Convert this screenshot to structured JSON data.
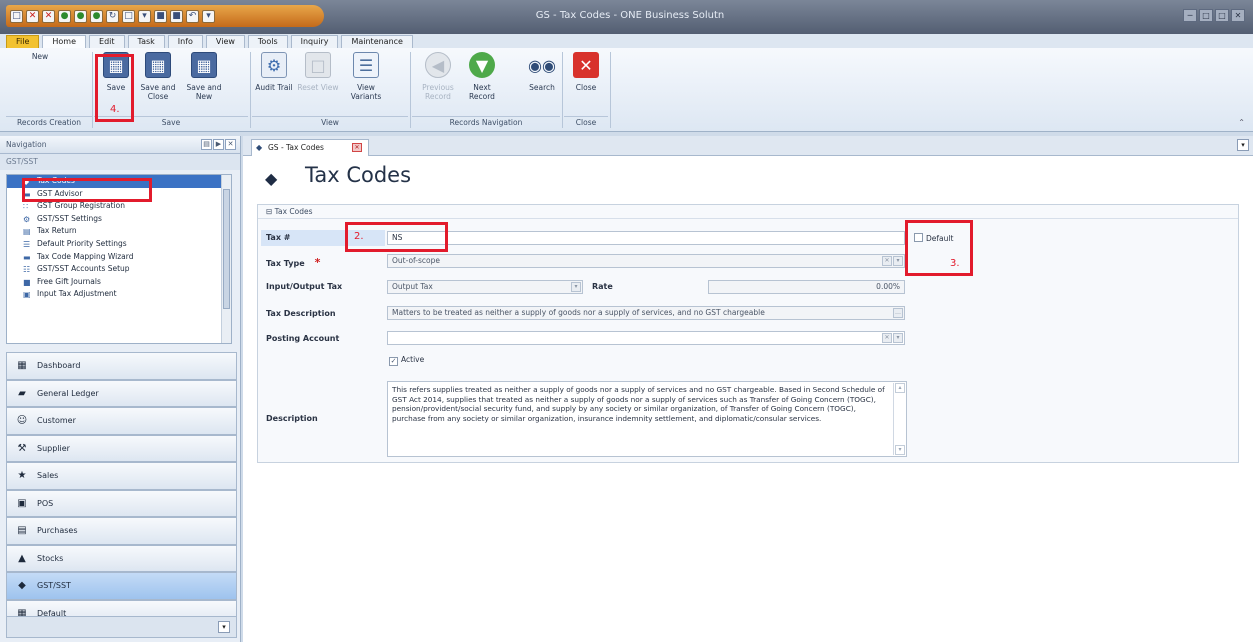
{
  "window": {
    "title": "GS - Tax Codes - ONE Business Solutn",
    "controls": [
      "─",
      "□",
      "□",
      "✕"
    ]
  },
  "quick_access": [
    "□",
    "✕",
    "✕",
    "●",
    "●",
    "●",
    "↻",
    "□",
    "▾",
    "■",
    "■",
    "↶",
    "▾"
  ],
  "ribbon_tabs": [
    "File",
    "Home",
    "Edit",
    "Task",
    "Info",
    "View",
    "Tools",
    "Inquiry",
    "Maintenance"
  ],
  "ribbon": {
    "buttons": {
      "new": "New",
      "save": "Save",
      "save_close": "Save and Close",
      "save_new": "Save and New",
      "audit_trail": "Audit Trail",
      "reset_view": "Reset View",
      "view_variants": "View Variants",
      "previous_record": "Previous Record",
      "next_record": "Next Record",
      "search": "Search",
      "close": "Close"
    },
    "groups": {
      "records_creation": "Records Creation",
      "save": "Save",
      "view": "View",
      "records_navigation": "Records Navigation",
      "close": "Close"
    }
  },
  "annotations": {
    "save_num": "4.",
    "tax_num": "2.",
    "default_num": "3."
  },
  "navigator": {
    "header": "Navigation",
    "tree_caption": "GST/SST",
    "items": [
      {
        "label": "Tax Codes",
        "icon": "◆",
        "selected": true
      },
      {
        "label": "GST Advisor",
        "icon": "▬"
      },
      {
        "label": "GST Group Registration",
        "icon": "∷"
      },
      {
        "label": "GST/SST Settings",
        "icon": "⚙"
      },
      {
        "label": "Tax Return",
        "icon": "▤"
      },
      {
        "label": "Default Priority Settings",
        "icon": "☰"
      },
      {
        "label": "Tax Code Mapping Wizard",
        "icon": "▬"
      },
      {
        "label": "GST/SST Accounts Setup",
        "icon": "☷"
      },
      {
        "label": "Free Gift Journals",
        "icon": "■"
      },
      {
        "label": "Input Tax Adjustment",
        "icon": "▣"
      }
    ],
    "sections": [
      {
        "label": "Dashboard",
        "icon": "▦"
      },
      {
        "label": "General Ledger",
        "icon": "▰"
      },
      {
        "label": "Customer",
        "icon": "☺"
      },
      {
        "label": "Supplier",
        "icon": "⚒"
      },
      {
        "label": "Sales",
        "icon": "★"
      },
      {
        "label": "POS",
        "icon": "▣"
      },
      {
        "label": "Purchases",
        "icon": "▤"
      },
      {
        "label": "Stocks",
        "icon": "▲"
      },
      {
        "label": "GST/SST",
        "icon": "◆",
        "selected": true
      },
      {
        "label": "Default",
        "icon": "▦"
      }
    ],
    "footer_btn": "▾"
  },
  "document": {
    "tab_label": "GS - Tax Codes",
    "page_title": "Tax Codes",
    "group_title": "Tax Codes",
    "fields": {
      "tax_label": "Tax #",
      "tax_value": "NS",
      "default_label": "Default",
      "tax_type_label": "Tax Type",
      "tax_type_value": "Out-of-scope",
      "io_tax_label": "Input/Output Tax",
      "io_tax_value": "Output Tax",
      "rate_label": "Rate",
      "rate_value": "0.00%",
      "tax_desc_label": "Tax Description",
      "tax_desc_value": "Matters to be treated as neither a supply of goods nor a supply of services, and no GST chargeable",
      "posting_label": "Posting Account",
      "posting_value": "",
      "active_label": "Active",
      "description_label": "Description",
      "description_value": "This refers supplies treated as neither a supply of goods nor a supply of services and no GST chargeable. Based in Second Schedule of GST Act 2014, supplies that treated as neither a supply of goods nor a supply of services such as Transfer of Going Concern (TOGC), pension/provident/social security fund, and supply by any society or similar organization, of Transfer of Going Concern (TOGC), purchase from any society or similar organization, insurance indemnity settlement, and diplomatic/consular services."
    }
  }
}
